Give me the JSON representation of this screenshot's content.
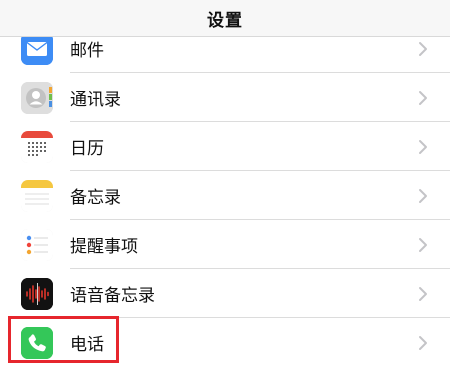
{
  "nav": {
    "title": "设置"
  },
  "rows": [
    {
      "label": "邮件",
      "icon": "mail-icon"
    },
    {
      "label": "通讯录",
      "icon": "contacts-icon"
    },
    {
      "label": "日历",
      "icon": "calendar-icon"
    },
    {
      "label": "备忘录",
      "icon": "notes-icon"
    },
    {
      "label": "提醒事项",
      "icon": "reminders-icon"
    },
    {
      "label": "语音备忘录",
      "icon": "voice-memos-icon"
    },
    {
      "label": "电话",
      "icon": "phone-icon",
      "highlighted": true
    }
  ],
  "colors": {
    "highlight": "#e6262d",
    "mail": "#3d8cf5",
    "phone": "#34c759",
    "calendar_red": "#e84a3c",
    "notes_yellow": "#f5c740",
    "voice_memos_red": "#ff3b30"
  }
}
